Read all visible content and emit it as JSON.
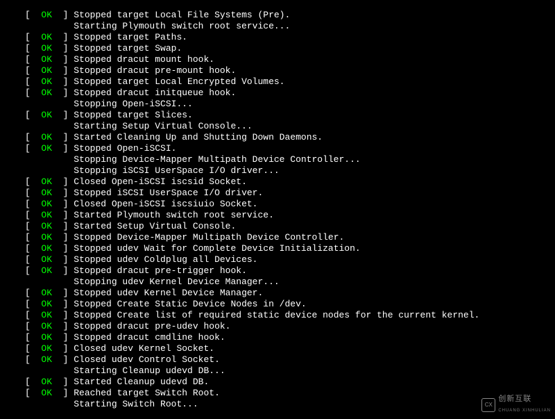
{
  "status_ok": "OK",
  "lines": [
    {
      "type": "ok",
      "msg": "Stopped target Local File Systems (Pre)."
    },
    {
      "type": "indent",
      "msg": "Starting Plymouth switch root service..."
    },
    {
      "type": "ok",
      "msg": "Stopped target Paths."
    },
    {
      "type": "ok",
      "msg": "Stopped target Swap."
    },
    {
      "type": "ok",
      "msg": "Stopped dracut mount hook."
    },
    {
      "type": "ok",
      "msg": "Stopped dracut pre-mount hook."
    },
    {
      "type": "ok",
      "msg": "Stopped target Local Encrypted Volumes."
    },
    {
      "type": "ok",
      "msg": "Stopped dracut initqueue hook."
    },
    {
      "type": "indent",
      "msg": "Stopping Open-iSCSI..."
    },
    {
      "type": "ok",
      "msg": "Stopped target Slices."
    },
    {
      "type": "indent",
      "msg": "Starting Setup Virtual Console..."
    },
    {
      "type": "ok",
      "msg": "Started Cleaning Up and Shutting Down Daemons."
    },
    {
      "type": "ok",
      "msg": "Stopped Open-iSCSI."
    },
    {
      "type": "indent",
      "msg": "Stopping Device-Mapper Multipath Device Controller..."
    },
    {
      "type": "indent",
      "msg": "Stopping iSCSI UserSpace I/O driver..."
    },
    {
      "type": "ok",
      "msg": "Closed Open-iSCSI iscsid Socket."
    },
    {
      "type": "ok",
      "msg": "Stopped iSCSI UserSpace I/O driver."
    },
    {
      "type": "ok",
      "msg": "Closed Open-iSCSI iscsiuio Socket."
    },
    {
      "type": "ok",
      "msg": "Started Plymouth switch root service."
    },
    {
      "type": "ok",
      "msg": "Started Setup Virtual Console."
    },
    {
      "type": "ok",
      "msg": "Stopped Device-Mapper Multipath Device Controller."
    },
    {
      "type": "ok",
      "msg": "Stopped udev Wait for Complete Device Initialization."
    },
    {
      "type": "ok",
      "msg": "Stopped udev Coldplug all Devices."
    },
    {
      "type": "ok",
      "msg": "Stopped dracut pre-trigger hook."
    },
    {
      "type": "indent",
      "msg": "Stopping udev Kernel Device Manager..."
    },
    {
      "type": "ok",
      "msg": "Stopped udev Kernel Device Manager."
    },
    {
      "type": "ok",
      "msg": "Stopped Create Static Device Nodes in /dev."
    },
    {
      "type": "ok",
      "msg": "Stopped Create list of required static device nodes for the current kernel."
    },
    {
      "type": "ok",
      "msg": "Stopped dracut pre-udev hook."
    },
    {
      "type": "ok",
      "msg": "Stopped dracut cmdline hook."
    },
    {
      "type": "ok",
      "msg": "Closed udev Kernel Socket."
    },
    {
      "type": "ok",
      "msg": "Closed udev Control Socket."
    },
    {
      "type": "indent",
      "msg": "Starting Cleanup udevd DB..."
    },
    {
      "type": "ok",
      "msg": "Started Cleanup udevd DB."
    },
    {
      "type": "ok",
      "msg": "Reached target Switch Root."
    },
    {
      "type": "indent",
      "msg": "Starting Switch Root..."
    }
  ],
  "watermark": {
    "brand": "创新互联",
    "sub": "CHUANG XINHULIAN",
    "logo": "CX"
  }
}
